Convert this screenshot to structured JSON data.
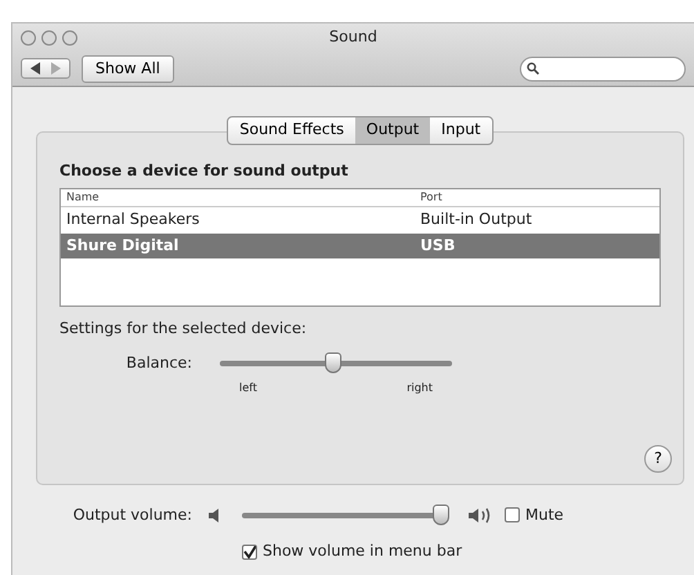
{
  "window": {
    "title": "Sound"
  },
  "toolbar": {
    "show_all": "Show All"
  },
  "tabs": [
    {
      "label": "Sound Effects",
      "selected": false
    },
    {
      "label": "Output",
      "selected": true
    },
    {
      "label": "Input",
      "selected": false
    }
  ],
  "heading": "Choose a device for sound output",
  "table": {
    "columns": [
      "Name",
      "Port"
    ],
    "rows": [
      {
        "cells": [
          "Internal Speakers",
          "Built-in Output"
        ],
        "selected": false
      },
      {
        "cells": [
          "Shure Digital",
          "USB"
        ],
        "selected": true
      }
    ]
  },
  "settings_label": "Settings for the selected device:",
  "balance": {
    "label": "Balance:",
    "level": 0.49,
    "min_label": "left",
    "max_label": "right"
  },
  "help": "?",
  "output_volume": {
    "label": "Output volume:",
    "level": 0.97
  },
  "mute": {
    "label": "Mute",
    "checked": false
  },
  "menu_bar": {
    "label": "Show volume in menu bar",
    "checked": true
  }
}
